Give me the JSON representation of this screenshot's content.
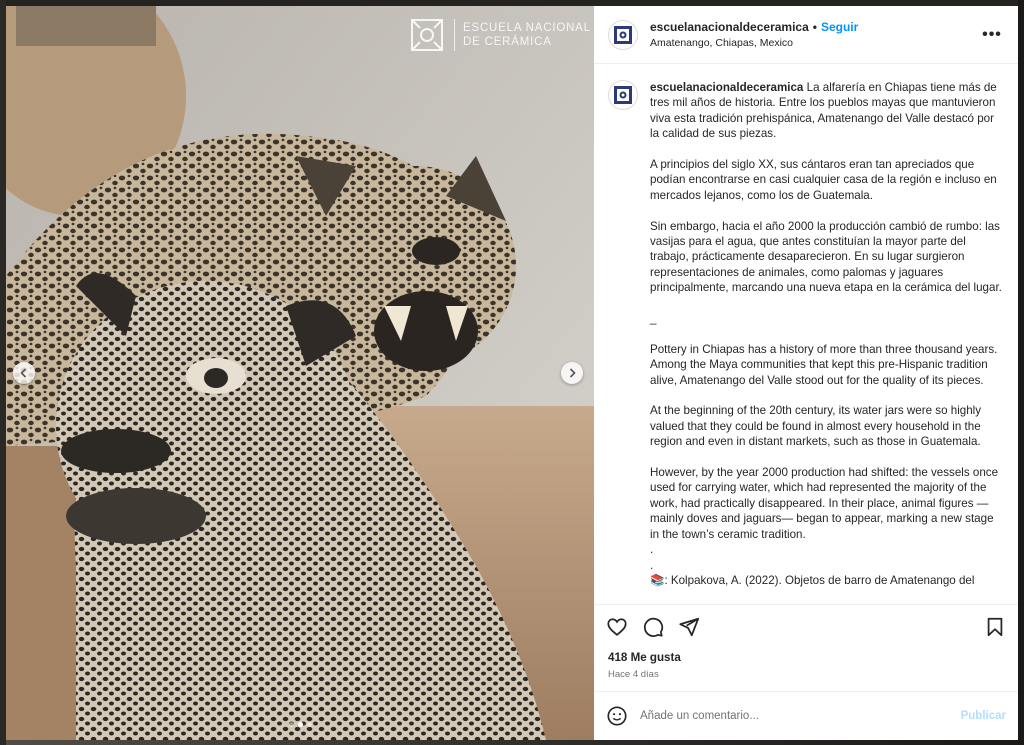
{
  "brand": {
    "watermark_line1": "ESCUELA NACIONAL",
    "watermark_line2": "DE CERÁMICA"
  },
  "carousel": {
    "slides": 3,
    "active_index": 1
  },
  "post": {
    "username": "escuelanacionaldeceramica",
    "separator": "•",
    "follow_label": "Seguir",
    "location": "Amatenango, Chiapas, Mexico",
    "more_label": "•••",
    "caption": {
      "p1": "La alfarería en Chiapas tiene más de tres mil años de historia. Entre los pueblos mayas que mantuvieron viva esta tradición prehispánica, Amatenango del Valle destacó por la calidad de sus piezas.",
      "p2": "A principios del siglo XX, sus cántaros eran tan apreciados que podían encontrarse en casi cualquier casa de la región e incluso en mercados lejanos, como los de Guatemala.",
      "p3": "Sin embargo, hacia el año 2000 la producción cambió de rumbo: las vasijas para el agua, que antes constituían la mayor parte del trabajo, prácticamente desaparecieron. En su lugar surgieron representaciones de animales, como palomas y jaguares principalmente, marcando una nueva etapa en la cerámica del lugar.",
      "divider": "_",
      "p4": "Pottery in Chiapas has a history of more than three thousand years. Among the Maya communities that kept this pre-Hispanic tradition alive, Amatenango del Valle stood out for the quality of its pieces.",
      "p5": "At the beginning of the 20th century, its water jars were so highly valued that they could be found in almost every household in the region and even in distant markets, such as those in Guatemala.",
      "p6": "However, by the year 2000 production had shifted: the vessels once used for carrying water, which had represented the majority of the work, had practically disappeared. In their place, animal figures — mainly doves and jaguars— began to appear, marking a new stage in the town’s ceramic tradition.",
      "dot1": ".",
      "dot2": ".",
      "reference_icon": "📚",
      "reference": ": Kolpakova, A. (2022). Objetos de barro de Amatenango del"
    },
    "likes": "418 Me gusta",
    "time": "Hace 4 días",
    "comment_placeholder": "Añade un comentario...",
    "publish_label": "Publicar"
  },
  "icons": {
    "like": "heart-icon",
    "comment": "comment-icon",
    "share": "share-icon",
    "save": "bookmark-icon",
    "emoji": "emoji-icon",
    "more": "more-icon",
    "prev": "chevron-left-icon",
    "next": "chevron-right-icon"
  },
  "colors": {
    "link": "#0095f6",
    "publish_disabled": "#b2dffc",
    "text": "#262626",
    "muted": "#737373"
  }
}
